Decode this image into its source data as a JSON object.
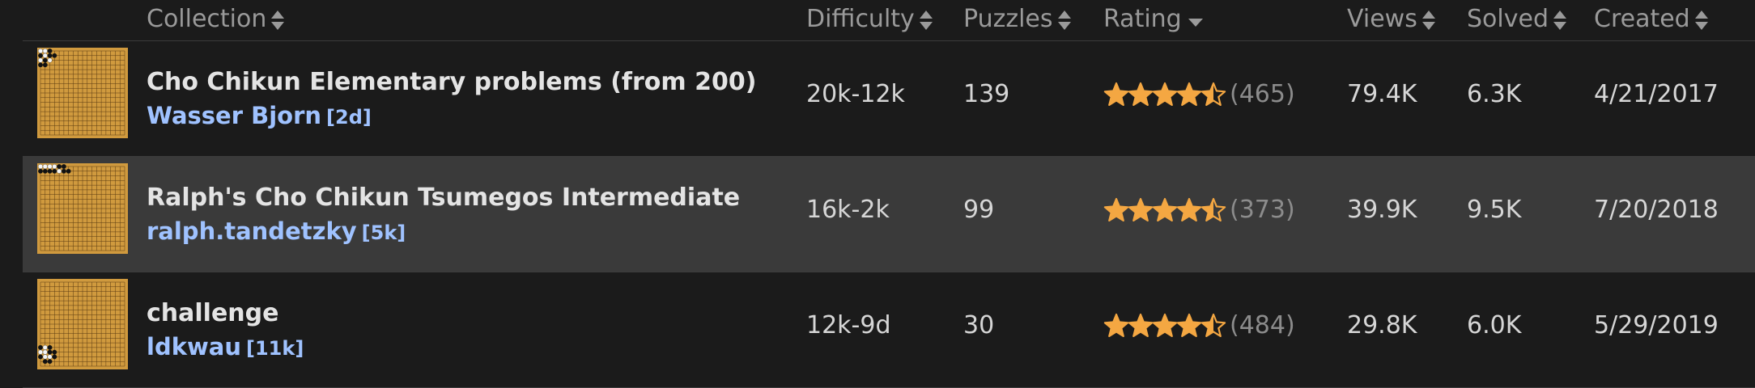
{
  "accent_star": "#f4a742",
  "author_color": "#9fc2ff",
  "headers": {
    "collection": "Collection",
    "difficulty": "Difficulty",
    "puzzles": "Puzzles",
    "rating": "Rating",
    "views": "Views",
    "solved": "Solved",
    "created": "Created"
  },
  "sort": {
    "column": "Rating",
    "direction": "descending"
  },
  "rows": [
    {
      "title": "Cho Chikun Elementary problems (from 200)",
      "author": "Wasser Bjorn",
      "rank": "[2d]",
      "difficulty": "20k-12k",
      "puzzles": "139",
      "rating_stars": 4.5,
      "rating_count": "(465)",
      "views": "79.4K",
      "solved": "6.3K",
      "created": "4/21/2017",
      "thumbnail_stone_corner": "top-left"
    },
    {
      "title": "Ralph's Cho Chikun Tsumegos Intermediate",
      "author": "ralph.tandetzky",
      "rank": "[5k]",
      "difficulty": "16k-2k",
      "puzzles": "99",
      "rating_stars": 4.5,
      "rating_count": "(373)",
      "views": "39.9K",
      "solved": "9.5K",
      "created": "7/20/2018",
      "thumbnail_stone_corner": "top-left"
    },
    {
      "title": "challenge",
      "author": "ldkwau",
      "rank": "[11k]",
      "difficulty": "12k-9d",
      "puzzles": "30",
      "rating_stars": 4.5,
      "rating_count": "(484)",
      "views": "29.8K",
      "solved": "6.0K",
      "created": "5/29/2019",
      "thumbnail_stone_corner": "bottom-left"
    }
  ]
}
